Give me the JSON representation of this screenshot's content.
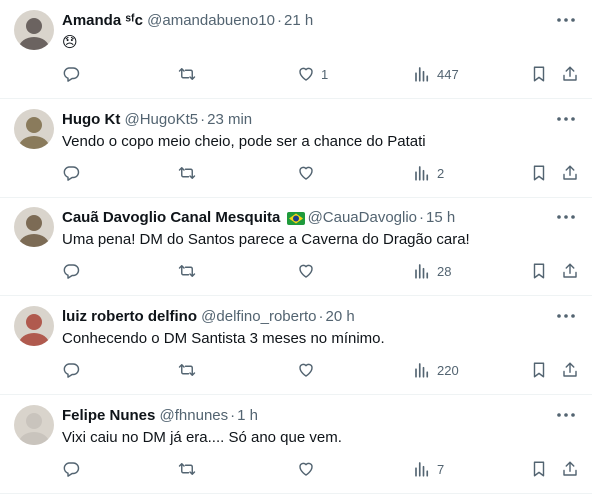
{
  "tweets": [
    {
      "name": "Amanda ˢᶠc",
      "handle": "@amandabueno10",
      "time": "21 h",
      "text": "😞",
      "replies": "",
      "retweets": "",
      "likes": "1",
      "views": "447",
      "avatar_color": "#6b6360"
    },
    {
      "name": "Hugo Kt",
      "handle": "@HugoKt5",
      "time": "23 min",
      "text": "Vendo o copo meio cheio, pode ser a chance do Patati",
      "replies": "",
      "retweets": "",
      "likes": "",
      "views": "2",
      "avatar_color": "#8a7b5c"
    },
    {
      "name": "Cauã Davoglio Canal Mesquita",
      "handle": "@CauaDavoglio",
      "time": "15 h",
      "text": "Uma pena! DM do Santos parece a Caverna do Dragão cara!",
      "replies": "",
      "retweets": "",
      "likes": "",
      "views": "28",
      "avatar_color": "#7c6b55",
      "flag_icon": "brazil-flag-icon"
    },
    {
      "name": "luiz roberto delfino",
      "handle": "@delfino_roberto",
      "time": "20 h",
      "text": "Conhecendo o DM Santista 3 meses no mínimo.",
      "replies": "",
      "retweets": "",
      "likes": "",
      "views": "220",
      "avatar_color": "#b05a4e"
    },
    {
      "name": "Felipe Nunes",
      "handle": "@fhnunes",
      "time": "1 h",
      "text": "Vixi caiu no DM já era.... Só ano que vem.",
      "replies": "",
      "retweets": "",
      "likes": "",
      "views": "7",
      "avatar_color": "#c9c4bd"
    }
  ],
  "icons": {
    "reply": "reply-icon",
    "retweet": "retweet-icon",
    "like": "heart-icon",
    "views": "views-icon",
    "bookmark": "bookmark-icon",
    "share": "share-icon",
    "more": "more-icon"
  },
  "colors": {
    "text_primary": "#0f1419",
    "text_secondary": "#536471",
    "divider": "#eff3f4"
  }
}
